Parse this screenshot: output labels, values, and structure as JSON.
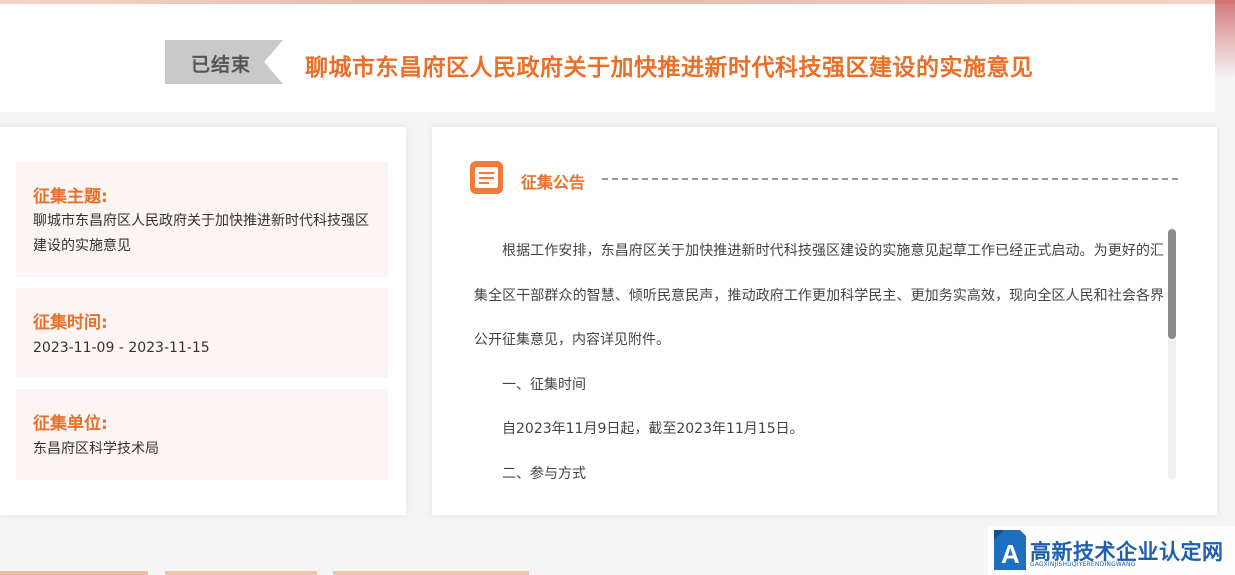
{
  "header": {
    "status": "已结束",
    "title": "聊城市东昌府区人民政府关于加快推进新时代科技强区建设的实施意见"
  },
  "info": {
    "topic_label": "征集主题:",
    "topic_value": "聊城市东昌府区人民政府关于加快推进新时代科技强区建设的实施意见",
    "time_label": "征集时间:",
    "time_value": "2023-11-09 - 2023-11-15",
    "unit_label": "征集单位:",
    "unit_value": "东昌府区科学技术局"
  },
  "notice": {
    "icon": "document-icon",
    "title": "征集公告",
    "paragraphs": [
      "根据工作安排，东昌府区关于加快推进新时代科技强区建设的实施意见起草工作已经正式启动。为更好的汇集全区干部群众的智慧、倾听民意民声，推动政府工作更加科学民主、更加务实高效，现向全区人民和社会各界公开征集意见，内容详见附件。",
      "一、征集时间",
      "自2023年11月9日起，截至2023年11月15日。",
      "二、参与方式"
    ]
  },
  "watermark": {
    "name": "高新技术企业认定网",
    "sub": "GAOXINJISHUQIYERENDINGWANG"
  },
  "colors": {
    "accent": "#e8702a",
    "tag_bg": "#c9c9c9",
    "info_bg": "#fdf5f3",
    "logo_blue": "#1e5fae"
  }
}
